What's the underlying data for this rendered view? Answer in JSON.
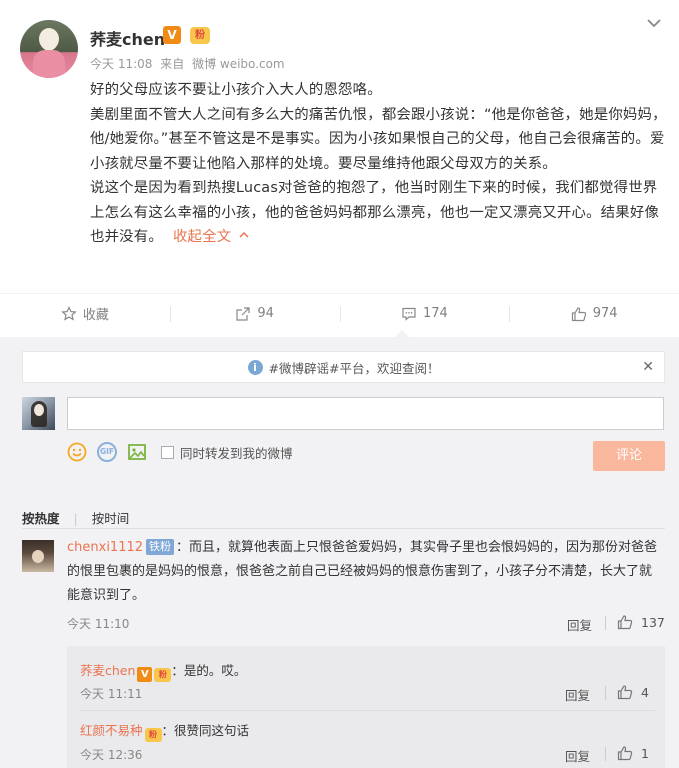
{
  "post": {
    "username": "荞麦chen",
    "v_badge": "V",
    "fan_badge": "粉",
    "time": "今天 11:08",
    "source_prefix": "来自",
    "source": "微博 weibo.com",
    "paragraphs": [
      "好的父母应该不要让小孩介入大人的恩怨咯。",
      "美剧里面不管大人之间有多么大的痛苦仇恨，都会跟小孩说：“他是你爸爸，她是你妈妈，他/她爱你。”甚至不管这是不是事实。因为小孩如果恨自己的父母，他自己会很痛苦的。爱小孩就尽量不要让他陷入那样的处境。要尽量维持他跟父母双方的关系。",
      "说这个是因为看到热搜Lucas对爸爸的抱怨了，他当时刚生下来的时候，我们都觉得世界上怎么有这么幸福的小孩，他的爸爸妈妈都那么漂亮，他也一定又漂亮又开心。结果好像也并没有。"
    ],
    "collapse_label": "收起全文"
  },
  "actions": {
    "favorite": "收藏",
    "repost": "94",
    "comment": "174",
    "like": "974"
  },
  "comment_area": {
    "notice": "#微博辟谣#平台，欢迎查阅！",
    "notice_icon": "i",
    "input_value": "",
    "gif_label": "GIF",
    "repost_label": "同时转发到我的微博",
    "submit_label": "评论",
    "sort_hot": "按热度",
    "sort_time": "按时间"
  },
  "comments": [
    {
      "user": "chenxi1112",
      "tag": "铁粉",
      "text": "：而且，就算他表面上只恨爸爸爱妈妈，其实骨子里也会恨妈妈的，因为那份对爸爸的恨里包裹的是妈妈的恨意，恨爸爸之前自己已经被妈妈的恨意伤害到了，小孩子分不清楚，长大了就能意识到了。",
      "time": "今天 11:10",
      "reply_label": "回复",
      "likes": "137"
    }
  ],
  "replies": [
    {
      "user": "荞麦chen",
      "v_badge": "V",
      "fan_badge": "粉",
      "text": "：是的。哎。",
      "time": "今天 11:11",
      "reply_label": "回复",
      "likes": "4"
    },
    {
      "user": "红颜不易种",
      "fan_badge": "粉",
      "text": "：很赞同这句话",
      "time": "今天 12:36",
      "reply_label": "回复",
      "likes": "1"
    }
  ],
  "colors": {
    "accent": "#eb7350",
    "submit_disabled": "#f9b79d",
    "comment_bg": "#f2f2f5",
    "verified": "#f08c16"
  },
  "icons": [
    "chevron-down-icon",
    "star-icon",
    "repost-icon",
    "comment-icon",
    "thumbs-up-icon",
    "info-icon",
    "close-icon",
    "emoji-icon",
    "gif-icon",
    "image-icon",
    "chevron-up-icon"
  ]
}
